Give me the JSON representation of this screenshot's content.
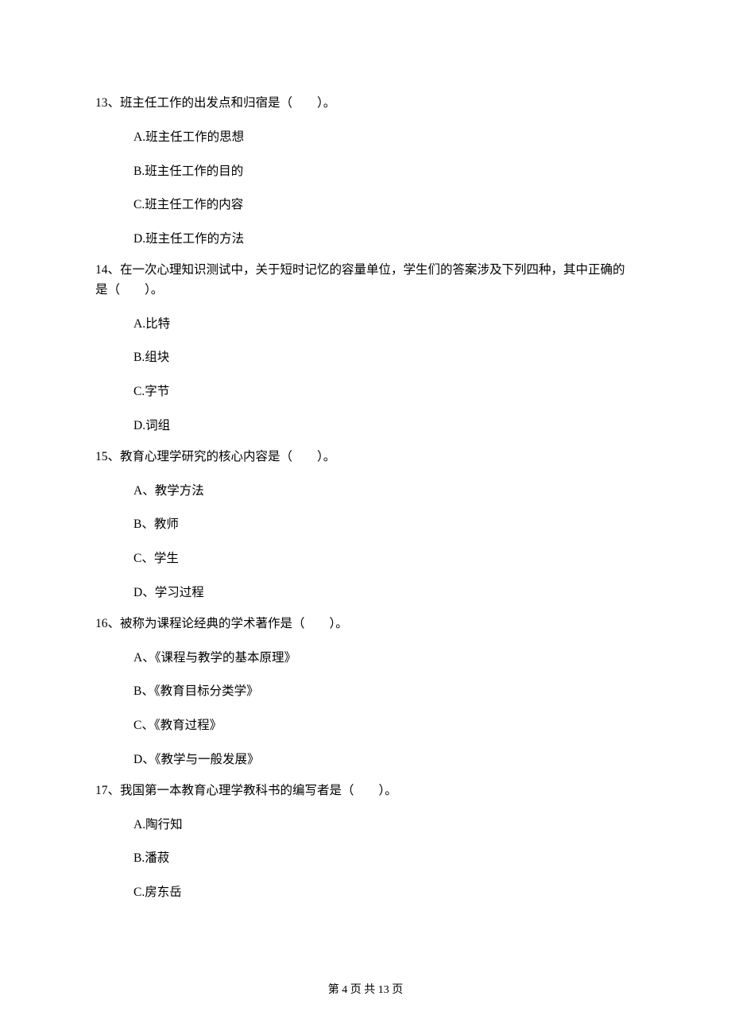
{
  "questions": [
    {
      "text": "13、班主任工作的出发点和归宿是（　　）。",
      "options": [
        "A.班主任工作的思想",
        "B.班主任工作的目的",
        "C.班主任工作的内容",
        "D.班主任工作的方法"
      ]
    },
    {
      "text": "14、在一次心理知识测试中，关于短时记忆的容量单位，学生们的答案涉及下列四种，其中正确的是（　　）。",
      "options": [
        "A.比特",
        "B.组块",
        "C.字节",
        "D.词组"
      ]
    },
    {
      "text": "15、教育心理学研究的核心内容是（　　）。",
      "options": [
        "A、教学方法",
        "B、教师",
        "C、学生",
        "D、学习过程"
      ]
    },
    {
      "text": "16、被称为课程论经典的学术著作是（　　）。",
      "options": [
        "A、《课程与教学的基本原理》",
        "B、《教育目标分类学》",
        "C、《教育过程》",
        "D、《教学与一般发展》"
      ]
    },
    {
      "text": "17、我国第一本教育心理学教科书的编写者是（　　）。",
      "options": [
        "A.陶行知",
        "B.潘菽",
        "C.房东岳"
      ]
    }
  ],
  "footer": "第 4 页 共 13 页"
}
